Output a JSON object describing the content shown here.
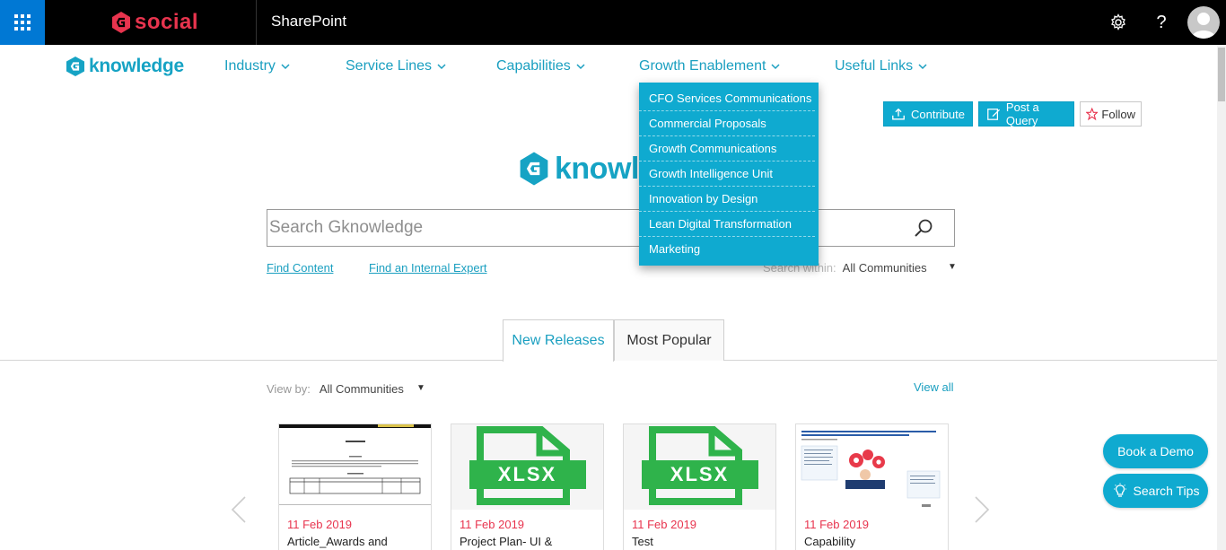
{
  "suitebar": {
    "brand": "social",
    "app_title": "SharePoint",
    "icons": [
      "waffle-icon",
      "gear-icon",
      "help-icon",
      "avatar"
    ]
  },
  "nav": {
    "logo": "knowledge",
    "items": [
      {
        "label": "Industry"
      },
      {
        "label": "Service Lines"
      },
      {
        "label": "Capabilities"
      },
      {
        "label": "Growth Enablement"
      },
      {
        "label": "Useful Links"
      }
    ]
  },
  "dropdown": {
    "items": [
      "CFO Services Communications",
      "Commercial Proposals",
      "Growth Communications",
      "Growth Intelligence Unit",
      "Innovation by Design",
      "Lean Digital Transformation",
      "Marketing"
    ]
  },
  "actions": {
    "contribute": "Contribute",
    "post_query": "Post a Query",
    "follow": "Follow"
  },
  "hero": {
    "logo_text": "knowle"
  },
  "search": {
    "placeholder": "Search Gknowledge",
    "find_content": "Find Content",
    "find_expert": "Find an Internal Expert",
    "within_label": "Search within:",
    "within_value": "All Communities"
  },
  "tabs": [
    {
      "label": "New Releases",
      "active": true
    },
    {
      "label": "Most Popular",
      "active": false
    }
  ],
  "viewby": {
    "label": "View by:",
    "value": "All Communities",
    "view_all": "View all"
  },
  "cards": [
    {
      "date": "11 Feb 2019",
      "title": "Article_Awards and",
      "thumb": "document"
    },
    {
      "date": "11 Feb 2019",
      "title": "Project Plan- UI &",
      "thumb": "xlsx"
    },
    {
      "date": "11 Feb 2019",
      "title": "Test",
      "thumb": "xlsx"
    },
    {
      "date": "11 Feb 2019",
      "title": "Capability",
      "thumb": "infographic"
    }
  ],
  "xlsx_label": "XLSX",
  "floating": {
    "book_demo": "Book a Demo",
    "search_tips": "Search Tips"
  },
  "colors": {
    "accent": "#0faad0",
    "brand_red": "#e8344e",
    "suite_bg": "#000000",
    "waffle_bg": "#0078d4",
    "xlsx_green": "#2fb34b"
  }
}
